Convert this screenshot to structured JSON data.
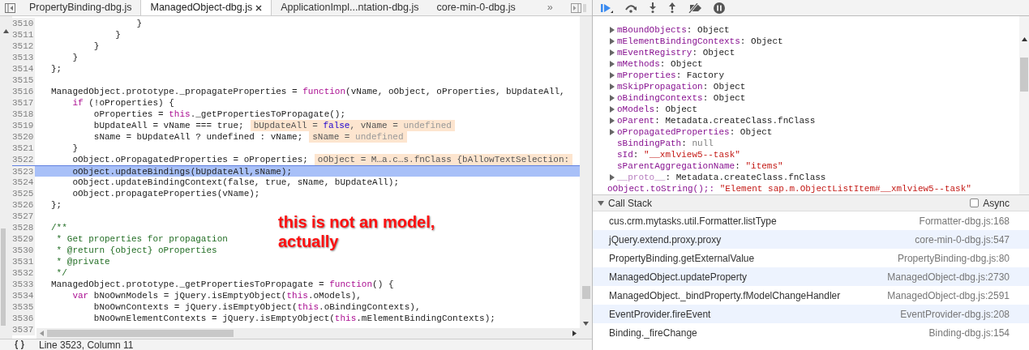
{
  "tabs": [
    {
      "label": "PropertyBinding-dbg.js",
      "selected": false,
      "closable": false
    },
    {
      "label": "ManagedObject-dbg.js",
      "selected": true,
      "closable": true
    },
    {
      "label": "ApplicationImpl...ntation-dbg.js",
      "selected": false,
      "closable": false
    },
    {
      "label": "core-min-0-dbg.js",
      "selected": false,
      "closable": false
    }
  ],
  "tabs_overflow": "»",
  "code": {
    "lines": [
      {
        "number": "3510",
        "selected": false,
        "segments": [
          {
            "kind": "plain",
            "text": "                }"
          }
        ]
      },
      {
        "number": "3511",
        "selected": false,
        "segments": [
          {
            "kind": "plain",
            "text": "            }"
          }
        ]
      },
      {
        "number": "3512",
        "selected": false,
        "segments": [
          {
            "kind": "plain",
            "text": "        }"
          }
        ]
      },
      {
        "number": "3513",
        "selected": false,
        "segments": [
          {
            "kind": "plain",
            "text": "    }"
          }
        ]
      },
      {
        "number": "3514",
        "selected": false,
        "segments": [
          {
            "kind": "plain",
            "text": "};"
          }
        ]
      },
      {
        "number": "3515",
        "selected": false
      },
      {
        "number": "3516",
        "selected": false,
        "segments": [
          {
            "kind": "plain",
            "text": "ManagedObject.prototype._propagateProperties = "
          },
          {
            "kind": "keyword",
            "text": "function"
          },
          {
            "kind": "plain",
            "text": "(vName, oObject, oProperties, bUpdateAll,"
          }
        ]
      },
      {
        "number": "3517",
        "selected": false,
        "segments": [
          {
            "kind": "keyword",
            "text": "    if"
          },
          {
            "kind": "plain",
            "text": " (!oProperties) {"
          }
        ]
      },
      {
        "number": "3518",
        "selected": false,
        "segments": [
          {
            "kind": "plain",
            "text": "        oProperties = "
          },
          {
            "kind": "keyword",
            "text": "this"
          },
          {
            "kind": "plain",
            "text": "._getPropertiesToPropagate();"
          }
        ]
      },
      {
        "number": "3519",
        "selected": false,
        "segments": [
          {
            "kind": "plain",
            "text": "        bUpdateAll = vName === true;"
          }
        ],
        "annotation": [
          {
            "kind": "plain",
            "text": "bUpdateAll = "
          },
          {
            "kind": "literal",
            "text": "false"
          },
          {
            "kind": "plain",
            "text": ", vName = "
          },
          {
            "kind": "muted",
            "text": "undefined"
          }
        ]
      },
      {
        "number": "3520",
        "selected": false,
        "segments": [
          {
            "kind": "plain",
            "text": "        sName = bUpdateAll ? undefined : vName;"
          }
        ],
        "annotation": [
          {
            "kind": "plain",
            "text": "sName = "
          },
          {
            "kind": "muted",
            "text": "undefined"
          }
        ]
      },
      {
        "number": "3521",
        "selected": false,
        "segments": [
          {
            "kind": "plain",
            "text": "    }"
          }
        ]
      },
      {
        "number": "3522",
        "selected": false,
        "segments": [
          {
            "kind": "plain",
            "text": "    oObject.oPropagatedProperties = oProperties;"
          }
        ],
        "annotation": [
          {
            "kind": "plain",
            "text": "oObject = M…a.c…s.fnClass {bAllowTextSelection:"
          }
        ]
      },
      {
        "number": "3523",
        "selected": true,
        "segments": [
          {
            "kind": "plain",
            "text": "    oObject.updateBindings(bUpdateAll,sName);"
          }
        ]
      },
      {
        "number": "3524",
        "selected": false,
        "segments": [
          {
            "kind": "plain",
            "text": "    oObject.updateBindingContext(false, true, sName, bUpdateAll);"
          }
        ]
      },
      {
        "number": "3525",
        "selected": false,
        "segments": [
          {
            "kind": "plain",
            "text": "    oObject.propagateProperties(vName);"
          }
        ]
      },
      {
        "number": "3526",
        "selected": false,
        "segments": [
          {
            "kind": "plain",
            "text": "};"
          }
        ]
      },
      {
        "number": "3527",
        "selected": false
      },
      {
        "number": "3528",
        "selected": false,
        "segments": [
          {
            "kind": "comment",
            "text": "/**"
          }
        ]
      },
      {
        "number": "3529",
        "selected": false,
        "segments": [
          {
            "kind": "comment",
            "text": " * Get properties for propagation"
          }
        ]
      },
      {
        "number": "3530",
        "selected": false,
        "segments": [
          {
            "kind": "comment",
            "text": " * @return {object} oProperties"
          }
        ]
      },
      {
        "number": "3531",
        "selected": false,
        "segments": [
          {
            "kind": "comment",
            "text": " * @private"
          }
        ]
      },
      {
        "number": "3532",
        "selected": false,
        "segments": [
          {
            "kind": "comment",
            "text": " */"
          }
        ]
      },
      {
        "number": "3533",
        "selected": false,
        "segments": [
          {
            "kind": "plain",
            "text": "ManagedObject.prototype._getPropertiesToPropagate = "
          },
          {
            "kind": "keyword",
            "text": "function"
          },
          {
            "kind": "plain",
            "text": "() {"
          }
        ]
      },
      {
        "number": "3534",
        "selected": false,
        "segments": [
          {
            "kind": "keyword",
            "text": "    var"
          },
          {
            "kind": "plain",
            "text": " bNoOwnModels = jQuery.isEmptyObject("
          },
          {
            "kind": "keyword",
            "text": "this"
          },
          {
            "kind": "plain",
            "text": ".oModels),"
          }
        ]
      },
      {
        "number": "3535",
        "selected": false,
        "segments": [
          {
            "kind": "plain",
            "text": "        bNoOwnContexts = jQuery.isEmptyObject("
          },
          {
            "kind": "keyword",
            "text": "this"
          },
          {
            "kind": "plain",
            "text": ".oBindingContexts),"
          }
        ]
      },
      {
        "number": "3536",
        "selected": false,
        "segments": [
          {
            "kind": "plain",
            "text": "        bNoOwnElementContexts = jQuery.isEmptyObject("
          },
          {
            "kind": "keyword",
            "text": "this"
          },
          {
            "kind": "plain",
            "text": ".mElementBindingContexts);"
          }
        ]
      },
      {
        "number": "3537",
        "selected": false
      }
    ]
  },
  "note": "this is not an model,\nactually",
  "status_bar": {
    "text": "Line 3523, Column 11"
  },
  "scope": {
    "items": [
      {
        "name": "mBoundObjects:",
        "value": "Object",
        "kind": "object",
        "expandable": true
      },
      {
        "name": "mElementBindingContexts:",
        "value": "Object",
        "kind": "object",
        "expandable": true
      },
      {
        "name": "mEventRegistry:",
        "value": "Object",
        "kind": "object",
        "expandable": true
      },
      {
        "name": "mMethods:",
        "value": "Object",
        "kind": "object",
        "expandable": true
      },
      {
        "name": "mProperties:",
        "value": "Factory",
        "kind": "object",
        "expandable": true
      },
      {
        "name": "mSkipPropagation:",
        "value": "Object",
        "kind": "object",
        "expandable": true
      },
      {
        "name": "oBindingContexts:",
        "value": "Object",
        "kind": "object",
        "expandable": true
      },
      {
        "name": "oModels:",
        "value": "Object",
        "kind": "object",
        "expandable": true
      },
      {
        "name": "oParent:",
        "value": "Metadata.createClass.fnClass",
        "kind": "object",
        "expandable": true
      },
      {
        "name": "oPropagatedProperties:",
        "value": "Object",
        "kind": "object",
        "expandable": true
      },
      {
        "name": "sBindingPath:",
        "value": "null",
        "kind": "null",
        "expandable": false
      },
      {
        "name": "sId:",
        "value": "\"__xmlview5--task\"",
        "kind": "string",
        "expandable": false
      },
      {
        "name": "sParentAggregationName:",
        "value": "\"items\"",
        "kind": "string",
        "expandable": false
      },
      {
        "name": "__proto__:",
        "value": "Metadata.createClass.fnClass",
        "kind": "proto",
        "expandable": true
      }
    ],
    "watch": {
      "expression": "oObject.toString();:",
      "value": "\"Element sap.m.ObjectListItem#__xmlview5--task\""
    }
  },
  "call_stack": {
    "title": "Call Stack",
    "expanded": true,
    "async": {
      "label": "Async",
      "checked": false
    },
    "frames": [
      {
        "function": "cus.crm.mytasks.util.Formatter.listType",
        "location": "Formatter-dbg.js:168"
      },
      {
        "function": "jQuery.extend.proxy.proxy",
        "location": "core-min-0-dbg.js:547"
      },
      {
        "function": "PropertyBinding.getExternalValue",
        "location": "PropertyBinding-dbg.js:80"
      },
      {
        "function": "ManagedObject.updateProperty",
        "location": "ManagedObject-dbg.js:2730"
      },
      {
        "function": "ManagedObject._bindProperty.fModelChangeHandler",
        "location": "ManagedObject-dbg.js:2591"
      },
      {
        "function": "EventProvider.fireEvent",
        "location": "EventProvider-dbg.js:208"
      },
      {
        "function": "Binding._fireChange",
        "location": "Binding-dbg.js:154"
      }
    ]
  }
}
